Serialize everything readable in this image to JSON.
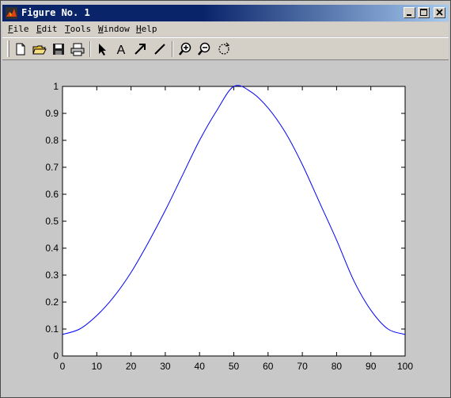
{
  "window": {
    "title": "Figure No. 1",
    "controls": [
      "minimize",
      "maximize",
      "close"
    ]
  },
  "menu": {
    "items": [
      {
        "label": "File",
        "accel": "F",
        "rest": "ile"
      },
      {
        "label": "Edit",
        "accel": "E",
        "rest": "dit"
      },
      {
        "label": "Tools",
        "accel": "T",
        "rest": "ools"
      },
      {
        "label": "Window",
        "accel": "W",
        "rest": "indow"
      },
      {
        "label": "Help",
        "accel": "H",
        "rest": "elp"
      }
    ]
  },
  "toolbar": {
    "buttons": [
      "new-file-icon",
      "open-folder-icon",
      "save-icon",
      "print-icon",
      "select-arrow-icon",
      "insert-text-icon",
      "insert-arrow-icon",
      "insert-line-icon",
      "zoom-in-icon",
      "zoom-out-icon",
      "rotate-3d-icon"
    ],
    "text_tool_glyph": "A"
  },
  "colors": {
    "figure_bg": "#c8c8c8",
    "axes_bg": "#ffffff",
    "line": "#0000ff",
    "titlebar_start": "#0a246a",
    "titlebar_end": "#a6caf0"
  },
  "chart_data": {
    "type": "line",
    "title": "",
    "xlabel": "",
    "ylabel": "",
    "xlim": [
      0,
      100
    ],
    "ylim": [
      0,
      1
    ],
    "xticks": [
      0,
      10,
      20,
      30,
      40,
      50,
      60,
      70,
      80,
      90,
      100
    ],
    "yticks": [
      0,
      0.1,
      0.2,
      0.3,
      0.4,
      0.5,
      0.6,
      0.7,
      0.8,
      0.9,
      1
    ],
    "xticklabels": [
      "0",
      "10",
      "20",
      "30",
      "40",
      "50",
      "60",
      "70",
      "80",
      "90",
      "100"
    ],
    "yticklabels": [
      "0",
      "0.1",
      "0.2",
      "0.3",
      "0.4",
      "0.5",
      "0.6",
      "0.7",
      "0.8",
      "0.9",
      "1"
    ],
    "grid": false,
    "series": [
      {
        "color": "#0000ff",
        "x": [
          0,
          5,
          10,
          15,
          20,
          25,
          30,
          35,
          40,
          45,
          50,
          55,
          60,
          65,
          70,
          75,
          80,
          85,
          90,
          95,
          100
        ],
        "y": [
          0.08,
          0.1,
          0.15,
          0.22,
          0.31,
          0.42,
          0.54,
          0.67,
          0.8,
          0.91,
          1.0,
          0.98,
          0.92,
          0.83,
          0.71,
          0.57,
          0.43,
          0.28,
          0.17,
          0.1,
          0.08
        ]
      }
    ]
  }
}
